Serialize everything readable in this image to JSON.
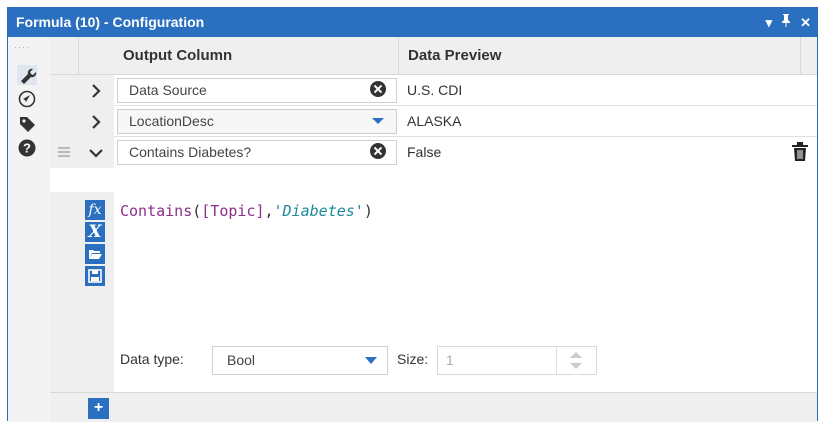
{
  "window": {
    "title": "Formula (10) - Configuration",
    "controls": {
      "dropdown": "▾",
      "pin": "📌",
      "close": "✕"
    }
  },
  "colors": {
    "accent": "#2a6fc0"
  },
  "sidebar": {
    "icons": [
      "wrench-icon",
      "navigate-icon",
      "tag-icon",
      "help-icon"
    ]
  },
  "grid": {
    "headers": {
      "output_column": "Output Column",
      "data_preview": "Data Preview"
    },
    "rows": [
      {
        "field": "Data Source",
        "control": "clear-icon",
        "preview": "U.S. CDI",
        "expanded": false
      },
      {
        "field": "LocationDesc",
        "control": "dropdown-icon",
        "preview": "ALASKA",
        "expanded": false
      },
      {
        "field": "Contains Diabetes?",
        "control": "clear-icon",
        "preview": "False",
        "expanded": true
      }
    ]
  },
  "editor": {
    "fn": "Contains",
    "open_paren": "(",
    "field": "[Topic]",
    "comma": ",",
    "string": "'Diabetes'",
    "close_paren": ")",
    "tools": [
      "fx-icon",
      "variable-icon",
      "open-icon",
      "save-icon"
    ]
  },
  "datatype": {
    "label": "Data type:",
    "value": "Bool",
    "size_label": "Size:",
    "size_value": "1"
  },
  "add_label": "+"
}
